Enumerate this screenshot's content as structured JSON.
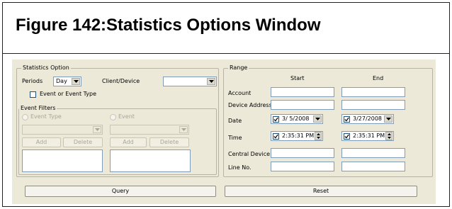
{
  "figure": {
    "title": "Figure 142:Statistics Options Window"
  },
  "statistics_option": {
    "legend": "Statistics Option",
    "periods_label": "Periods",
    "periods_value": "Day",
    "client_device_label": "Client/Device",
    "client_device_value": "",
    "event_checkbox_label": "Event or Event Type",
    "event_checkbox_checked": false,
    "event_filters": {
      "legend": "Event Filters",
      "event_type_label": "Event Type",
      "event_label": "Event",
      "add_label": "Add",
      "delete_label": "Delete"
    }
  },
  "range": {
    "legend": "Range",
    "start_header": "Start",
    "end_header": "End",
    "rows": {
      "account": "Account",
      "device_address": "Device Address",
      "date": "Date",
      "time": "Time",
      "central_device": "Central Device",
      "line_no": "Line No."
    },
    "date_start": "3/ 5/2008",
    "date_end": "3/27/2008",
    "time_start": "2:35:31 PM",
    "time_end": "2:35:31 PM"
  },
  "buttons": {
    "query": "Query",
    "reset": "Reset"
  },
  "colors": {
    "dialog_bg": "#ece9d8",
    "field_border": "#7f9db9",
    "disabled_text": "#a9a59a"
  }
}
